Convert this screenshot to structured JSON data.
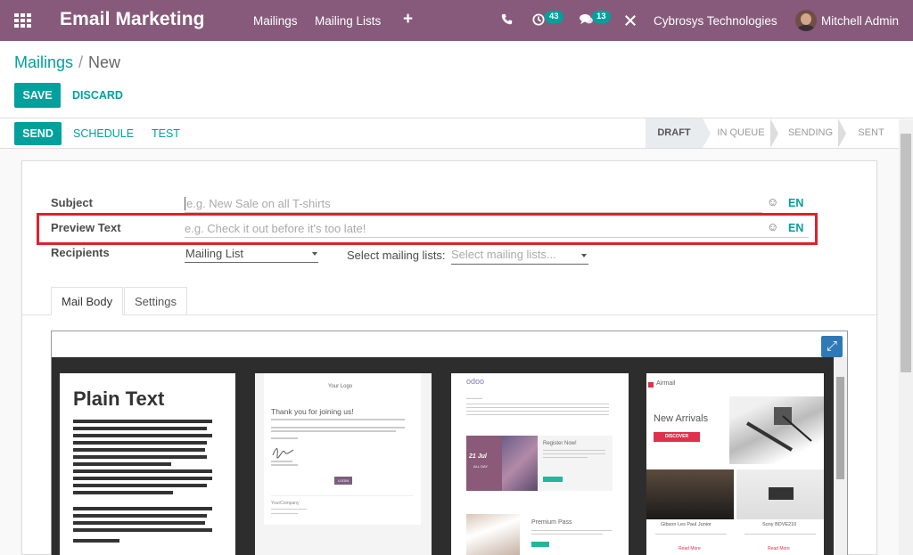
{
  "navbar": {
    "app_title": "Email Marketing",
    "menu": [
      "Mailings",
      "Mailing Lists"
    ],
    "activity_count": "43",
    "message_count": "13",
    "company": "Cybrosys Technologies",
    "user": "Mitchell Admin",
    "bg_color": "#875a7b"
  },
  "breadcrumb": {
    "parent": "Mailings",
    "sep": "/",
    "current": "New"
  },
  "control": {
    "save": "SAVE",
    "discard": "DISCARD"
  },
  "statusbar": {
    "actions": {
      "send": "SEND",
      "schedule": "SCHEDULE",
      "test": "TEST"
    },
    "stages": [
      "DRAFT",
      "IN QUEUE",
      "SENDING",
      "SENT"
    ],
    "active_stage": "DRAFT"
  },
  "form": {
    "subject": {
      "label": "Subject",
      "placeholder": "e.g. New Sale on all T-shirts",
      "lang": "EN"
    },
    "preview_text": {
      "label": "Preview Text",
      "placeholder": "e.g. Check it out before it's too late!",
      "lang": "EN"
    },
    "recipients": {
      "label": "Recipients",
      "value": "Mailing List"
    },
    "mailing_lists": {
      "label": "Select mailing lists:",
      "placeholder": "Select mailing lists..."
    }
  },
  "tabs": [
    "Mail Body",
    "Settings"
  ],
  "templates": {
    "plain": {
      "title": "Plain Text"
    },
    "welcome": {
      "logo": "Your Logo",
      "heading": "Thank you for joining us!",
      "button": "LOGIN",
      "footer": "YourCompany"
    },
    "event": {
      "logo": "odoo",
      "date_day": "21 Jul",
      "date_label": "ALL DAY",
      "register": "Register Now!",
      "pass": "Premium Pass"
    },
    "newsletter": {
      "brand": "Airmail",
      "heading": "New Arrivals",
      "button": "DISCOVER",
      "item1": "Gibson Les Paul Junior",
      "item2": "Sony BDVE210",
      "more": "Read More"
    }
  },
  "colors": {
    "accent": "#00a09d",
    "highlight": "#e0202e",
    "primary_dark": "#875a7b"
  }
}
